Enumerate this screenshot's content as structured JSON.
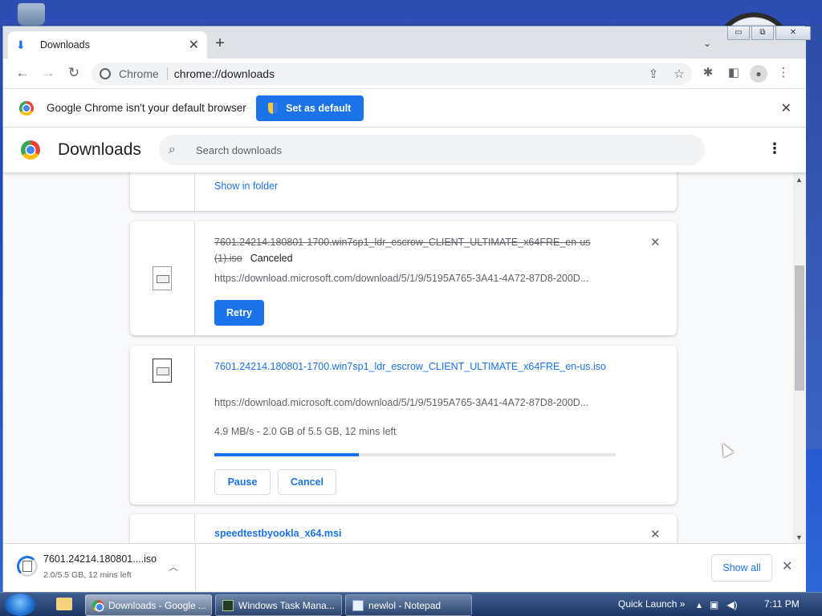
{
  "window": {
    "tab_title": "Downloads",
    "new_tab": "+",
    "win_buttons": [
      "▭",
      "⧉",
      "✕"
    ]
  },
  "toolbar": {
    "site_label": "Chrome",
    "url": "chrome://downloads"
  },
  "infobar": {
    "message": "Google Chrome isn't your default browser",
    "set_default_label": "Set as default"
  },
  "downloads_header": {
    "title": "Downloads",
    "search_placeholder": "Search downloads"
  },
  "downloads": {
    "item0": {
      "show_in_folder": "Show in folder"
    },
    "item1": {
      "filename": "7601.24214.180801-1700.win7sp1_ldr_escrow_CLIENT_ULTIMATE_x64FRE_en-us (1).iso",
      "status": "Canceled",
      "url": "https://download.microsoft.com/download/5/1/9/5195A765-3A41-4A72-87D8-200D...",
      "retry_label": "Retry"
    },
    "item2": {
      "filename": "7601.24214.180801-1700.win7sp1_ldr_escrow_CLIENT_ULTIMATE_x64FRE_en-us.iso",
      "url": "https://download.microsoft.com/download/5/1/9/5195A765-3A41-4A72-87D8-200D...",
      "progress_text": "4.9 MB/s - 2.0 GB of 5.5 GB, 12 mins left",
      "progress_fraction": 0.36,
      "pause_label": "Pause",
      "cancel_label": "Cancel"
    },
    "item3": {
      "filename": "speedtestbyookla_x64.msi"
    }
  },
  "shelf": {
    "item_name": "7601.24214.180801....iso",
    "item_status": "2.0/5.5 GB, 12 mins left",
    "show_all_label": "Show all"
  },
  "taskbar": {
    "buttons": [
      {
        "label": "Downloads - Google ..."
      },
      {
        "label": "Windows Task Mana..."
      },
      {
        "label": "newlol - Notepad"
      }
    ],
    "quick_launch": "Quick Launch",
    "clock": "7:11 PM"
  },
  "colors": {
    "accent": "#1a73e8",
    "desktop": "#2d4fb3"
  }
}
